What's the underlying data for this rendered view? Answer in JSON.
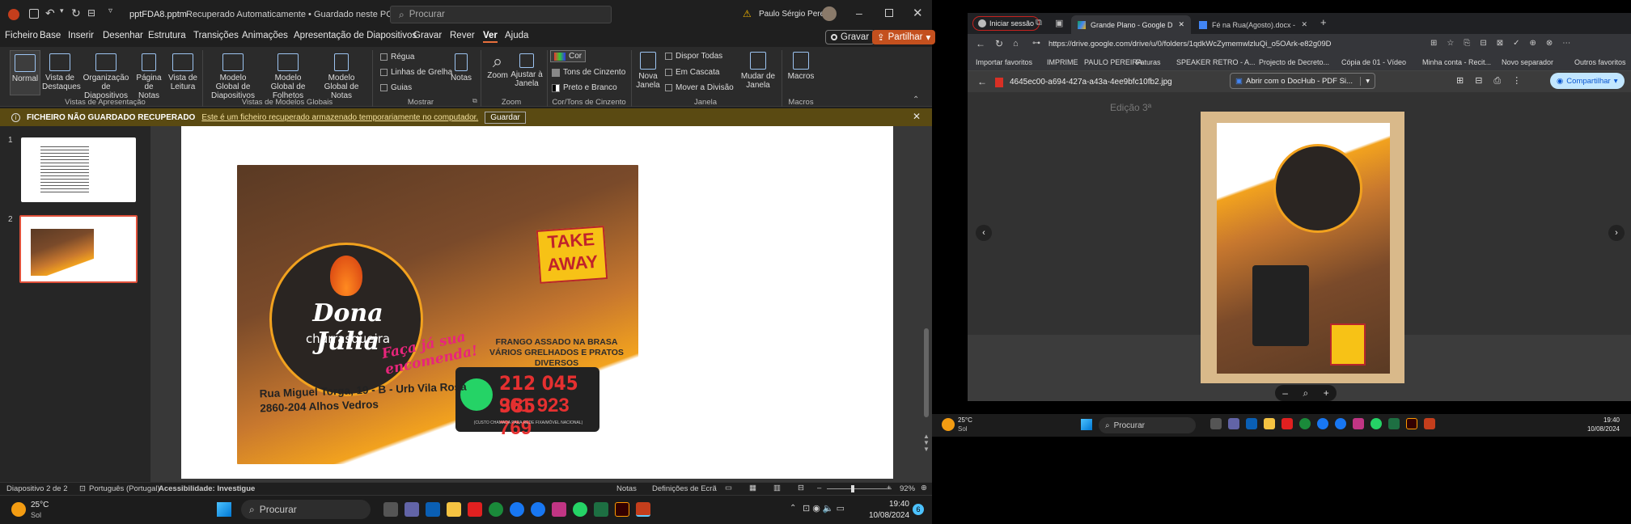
{
  "ppt": {
    "filename": "pptFDA8.pptm",
    "save_state": "Recuperado Automaticamente • Guardado neste PC",
    "search_placeholder": "Procurar",
    "user_name": "Paulo Sérgio Pereira",
    "menu": [
      "Ficheiro",
      "Base",
      "Inserir",
      "Desenhar",
      "Estrutura",
      "Transições",
      "Animações",
      "Apresentação de Diapositivos",
      "Gravar",
      "Rever",
      "Ver",
      "Ajuda"
    ],
    "active_menu": "Ver",
    "record_btn": "Gravar",
    "share_btn": "Partilhar",
    "ribbon": {
      "normal": "Normal",
      "vista_destaques": "Vista de Destaques",
      "organizacao": "Organização de Diapositivos",
      "pagina_notas": "Página de Notas",
      "vista_leitura": "Vista de Leitura",
      "grp_vistas": "Vistas de Apresentação",
      "mg_diapositivos": "Modelo Global de Diapositivos",
      "mg_folhetos": "Modelo Global de Folhetos",
      "mg_notas": "Modelo Global de Notas",
      "grp_modelos": "Vistas de Modelos Globais",
      "regua": "Régua",
      "linhas_grelha": "Linhas de Grelha",
      "guias": "Guias",
      "notas": "Notas",
      "grp_mostrar": "Mostrar",
      "zoom": "Zoom",
      "ajustar": "Ajustar à Janela",
      "grp_zoom": "Zoom",
      "cor": "Cor",
      "tons_cinzento": "Tons de Cinzento",
      "preto_branco": "Preto e Branco",
      "grp_cor": "Cor/Tons de Cinzento",
      "nova_janela": "Nova Janela",
      "dispor_todas": "Dispor Todas",
      "em_cascata": "Em Cascata",
      "mover_divisao": "Mover a Divisão",
      "mudar_janela": "Mudar de Janela",
      "grp_janela": "Janela",
      "macros": "Macros",
      "grp_macros": "Macros"
    },
    "warning": {
      "title": "FICHEIRO NÃO GUARDADO RECUPERADO",
      "message": "Este é um ficheiro recuperado armazenado temporariamente no computador.",
      "button": "Guardar"
    },
    "slides": [
      "1",
      "2"
    ],
    "status": {
      "slide": "Diapositivo 2 de 2",
      "language": "Português (Portugal)",
      "accessibility": "Acessibilidade: Investigue",
      "notes": "Notas",
      "display": "Definições de Ecrã",
      "zoom": "92%"
    }
  },
  "card": {
    "brand": "Dona Júlia",
    "subtitle": "churrasqueira",
    "take": "TAKE",
    "away": "AWAY",
    "slogan_1": "Faça já sua",
    "slogan_2": "encomenda!",
    "tagline_1": "FRANGO ASSADO NA BRASA",
    "tagline_2": "VÁRIOS GRELHADOS E PRATOS DIVERSOS",
    "phone_1": "212 045 385",
    "phone_2": "961 923 769",
    "phone_note": "(CUSTO CHAMADA PARA REDE FIXA/MÓVEL NACIONAL)",
    "address_1": "Rua Miguel Torga, 19 - B - Urb Vila Rosa",
    "address_2": "2860-204 Alhos Vedros"
  },
  "chrome": {
    "signin": "Iniciar sessão",
    "tab1": "Grande Plano - Google Drive",
    "tab2": "Fé na Rua(Agosto).docx - Docum",
    "url": "https://drive.google.com/drive/u/0/folders/1qdkWcZymemwlzluQi_o5OArk-e82g09D",
    "bookmarks": [
      "Importar favoritos",
      "IMPRIME",
      "PAULO PEREIRA",
      "Faturas",
      "SPEAKER RETRO - A...",
      "Projecto de Decreto...",
      "Cópia de 01 - Vídeo",
      "Minha conta - Recit...",
      "Novo separador",
      "Outros favoritos"
    ],
    "file_name": "4645ec00-a694-427a-a43a-4ee9bfc10fb2.jpg",
    "open_with": "Abrir com o DocHub - PDF Si...",
    "share": "Compartilhar",
    "bg_title": "Edição 3ª"
  },
  "taskbar": {
    "temp": "25°C",
    "weather": "Sol",
    "search": "Procurar",
    "time": "19:40",
    "date": "10/08/2024",
    "notif": "6"
  }
}
